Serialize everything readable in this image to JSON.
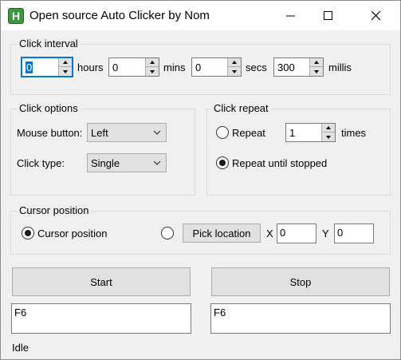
{
  "window": {
    "title": "Open source Auto Clicker by Nom",
    "icon_letter": "H"
  },
  "click_interval": {
    "label": "Click interval",
    "hours_value": "0",
    "hours_label": "hours",
    "mins_value": "0",
    "mins_label": "mins",
    "secs_value": "0",
    "secs_label": "secs",
    "millis_value": "300",
    "millis_label": "millis"
  },
  "click_options": {
    "label": "Click options",
    "mouse_button_label": "Mouse button:",
    "mouse_button_value": "Left",
    "click_type_label": "Click type:",
    "click_type_value": "Single"
  },
  "click_repeat": {
    "label": "Click repeat",
    "repeat_label": "Repeat",
    "repeat_value": "1",
    "times_label": "times",
    "repeat_until_stopped_label": "Repeat until stopped",
    "selected": "repeat_until_stopped"
  },
  "cursor_position": {
    "label": "Cursor position",
    "current_label": "Cursor position",
    "pick_location_label": "Pick location",
    "x_label": "X",
    "x_value": "0",
    "y_label": "Y",
    "y_value": "0",
    "selected": "current"
  },
  "actions": {
    "start_label": "Start",
    "stop_label": "Stop",
    "start_hotkey": "F6",
    "stop_hotkey": "F6"
  },
  "status": {
    "text": "Idle"
  },
  "icons": [
    "app-icon",
    "minimize-icon",
    "maximize-icon",
    "close-icon",
    "chevron-down-icon"
  ]
}
